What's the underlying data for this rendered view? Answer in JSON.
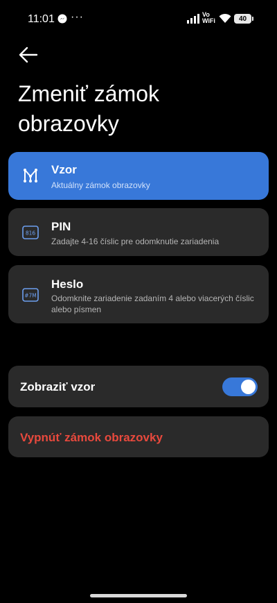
{
  "status_bar": {
    "time": "11:01",
    "more": "···",
    "vowifi_top": "Vo",
    "vowifi_bottom": "WiFi",
    "battery": "40",
    "icons": [
      "messenger-icon",
      "signal-icon",
      "wifi-icon"
    ]
  },
  "header": {
    "back_icon": "arrow-left-icon",
    "title": "Zmeniť zámok obrazovky"
  },
  "lock_options": [
    {
      "title": "Vzor",
      "description": "Aktuálny zámok obrazovky",
      "icon": "pattern-icon",
      "selected": true
    },
    {
      "title": "PIN",
      "description": "Zadajte 4-16 číslic pre odomknutie zariadenia",
      "icon": "pin-icon",
      "icon_text": "816",
      "selected": false
    },
    {
      "title": "Heslo",
      "description": "Odomknite zariadenie zadaním 4 alebo viacerých číslic alebo písmen",
      "icon": "password-icon",
      "icon_text": "#7M",
      "selected": false
    }
  ],
  "show_pattern": {
    "label": "Zobraziť vzor",
    "enabled": true
  },
  "disable_lock": {
    "label": "Vypnúť zámok obrazovky"
  },
  "colors": {
    "accent": "#3878d9",
    "card": "#2a2a2a",
    "danger": "#e8493d",
    "background": "#000000"
  }
}
